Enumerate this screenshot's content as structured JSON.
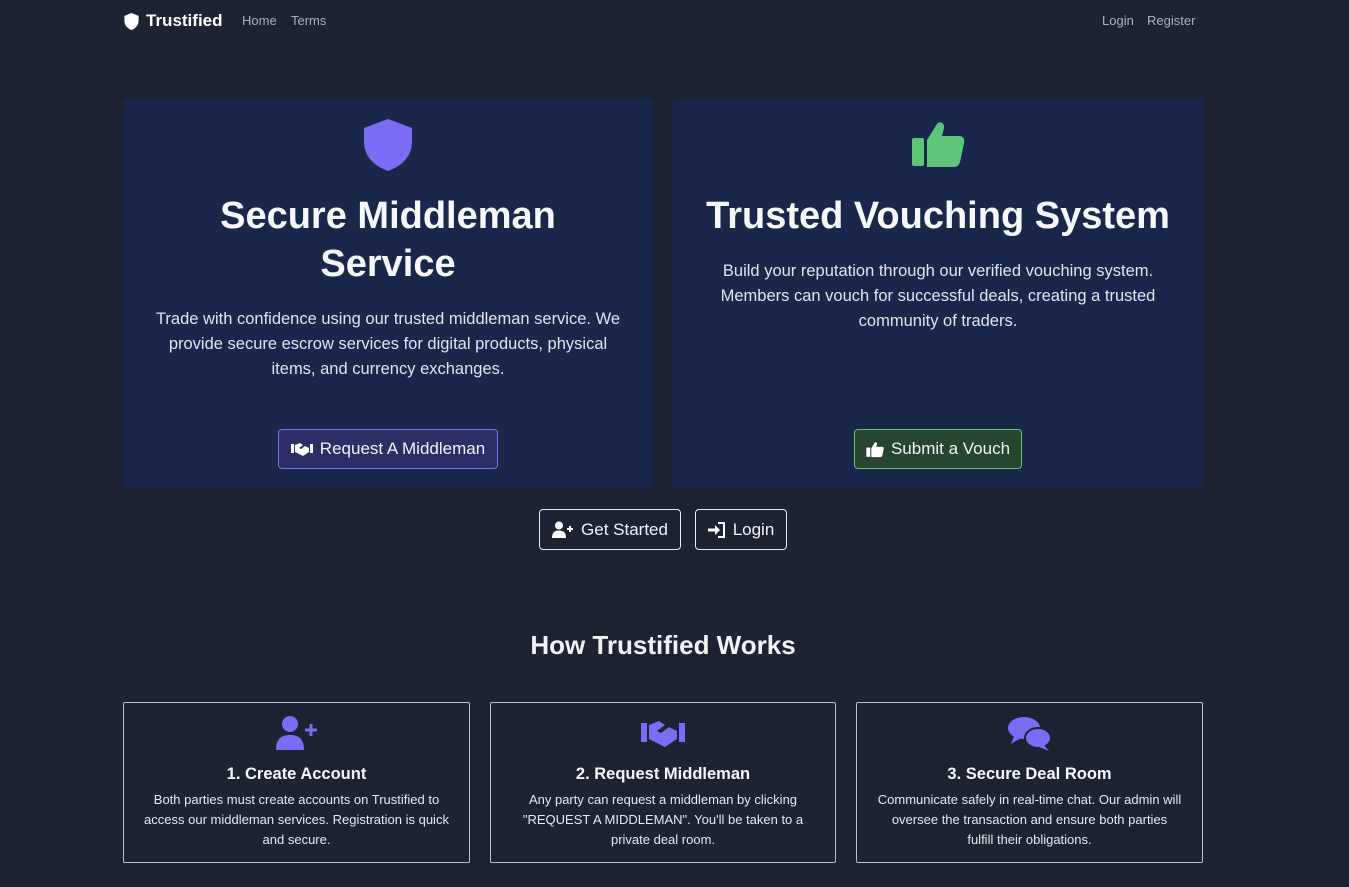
{
  "navbar": {
    "brand": "Trustified",
    "links": [
      "Home",
      "Terms"
    ],
    "right_links": [
      "Login",
      "Register"
    ]
  },
  "hero": {
    "middleman": {
      "icon": "shield-icon",
      "title_line1": "Secure Middleman",
      "title_line2": "Service",
      "description_lines": [
        "Trade with confidence using our trusted middleman service. We",
        "provide secure escrow services for digital products, physical",
        "items, and currency exchanges."
      ],
      "button_label": "Request A Middleman",
      "button_icon": "handshake-icon"
    },
    "vouching": {
      "icon": "thumbs-up-icon",
      "title": "Trusted Vouching System",
      "description_lines": [
        "Build your reputation through our verified vouching system.",
        "Members can vouch for successful deals, creating a trusted",
        "community of traders."
      ],
      "button_label": "Submit a Vouch",
      "button_icon": "thumbs-up-icon"
    }
  },
  "cta": {
    "get_started": "Get Started",
    "login": "Login"
  },
  "how_it_works": {
    "title": "How Trustified Works",
    "steps": [
      {
        "icon": "user-plus-icon",
        "title": "1. Create Account",
        "lines": [
          "Both parties must create accounts on Trustified to",
          "access our middleman services. Registration is quick",
          "and secure."
        ]
      },
      {
        "icon": "handshake-icon",
        "title": "2. Request Middleman",
        "lines": [
          "Any party can request a middleman by clicking",
          "\"REQUEST A MIDDLEMAN\". You'll be taken to a",
          "private deal room."
        ]
      },
      {
        "icon": "chat-bubbles-icon",
        "title": "3. Secure Deal Room",
        "lines": [
          "Communicate safely in real-time chat. Our admin will",
          "oversee the transaction and ensure both parties",
          "fulfill their obligations."
        ]
      }
    ]
  },
  "colors": {
    "background": "#1d2333",
    "card": "#19284a",
    "accent_purple": "#7b6cf5",
    "accent_green": "#5fc57b"
  }
}
